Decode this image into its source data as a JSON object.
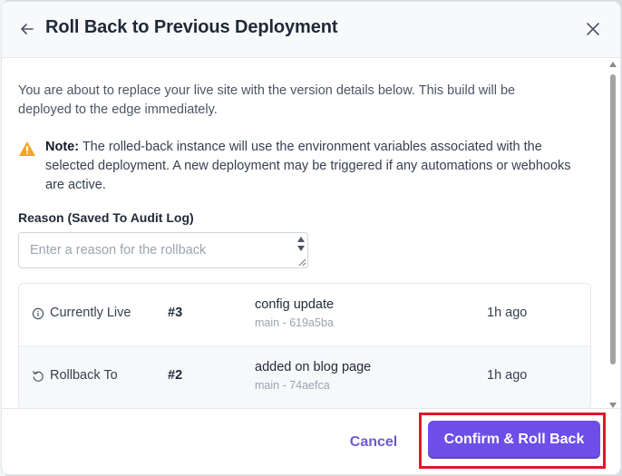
{
  "modal": {
    "title": "Roll Back to Previous Deployment",
    "intro": "You are about to replace your live site with the version details below. This build will be deployed to the edge immediately.",
    "note_label": "Note:",
    "note_text": " The rolled-back instance will use the environment variables associated with the selected deployment. A new deployment may be triggered if any automations or webhooks are active.",
    "reason_label": "Reason (Saved To Audit Log)",
    "reason_placeholder": "Enter a reason for the rollback",
    "reason_value": ""
  },
  "deployments": [
    {
      "label": "Currently Live",
      "icon": "info-circle-icon",
      "number": "#3",
      "message": "config update",
      "ref": "main - 619a5ba",
      "time": "1h ago"
    },
    {
      "label": "Rollback To",
      "icon": "rotate-ccw-icon",
      "number": "#2",
      "message": "added on blog page",
      "ref": "main - 74aefca",
      "time": "1h ago"
    }
  ],
  "footer": {
    "cancel_label": "Cancel",
    "confirm_label": "Confirm & Roll Back"
  },
  "colors": {
    "accent": "#6d4ee8",
    "highlight": "#e0162b",
    "warning": "#f5a623"
  }
}
